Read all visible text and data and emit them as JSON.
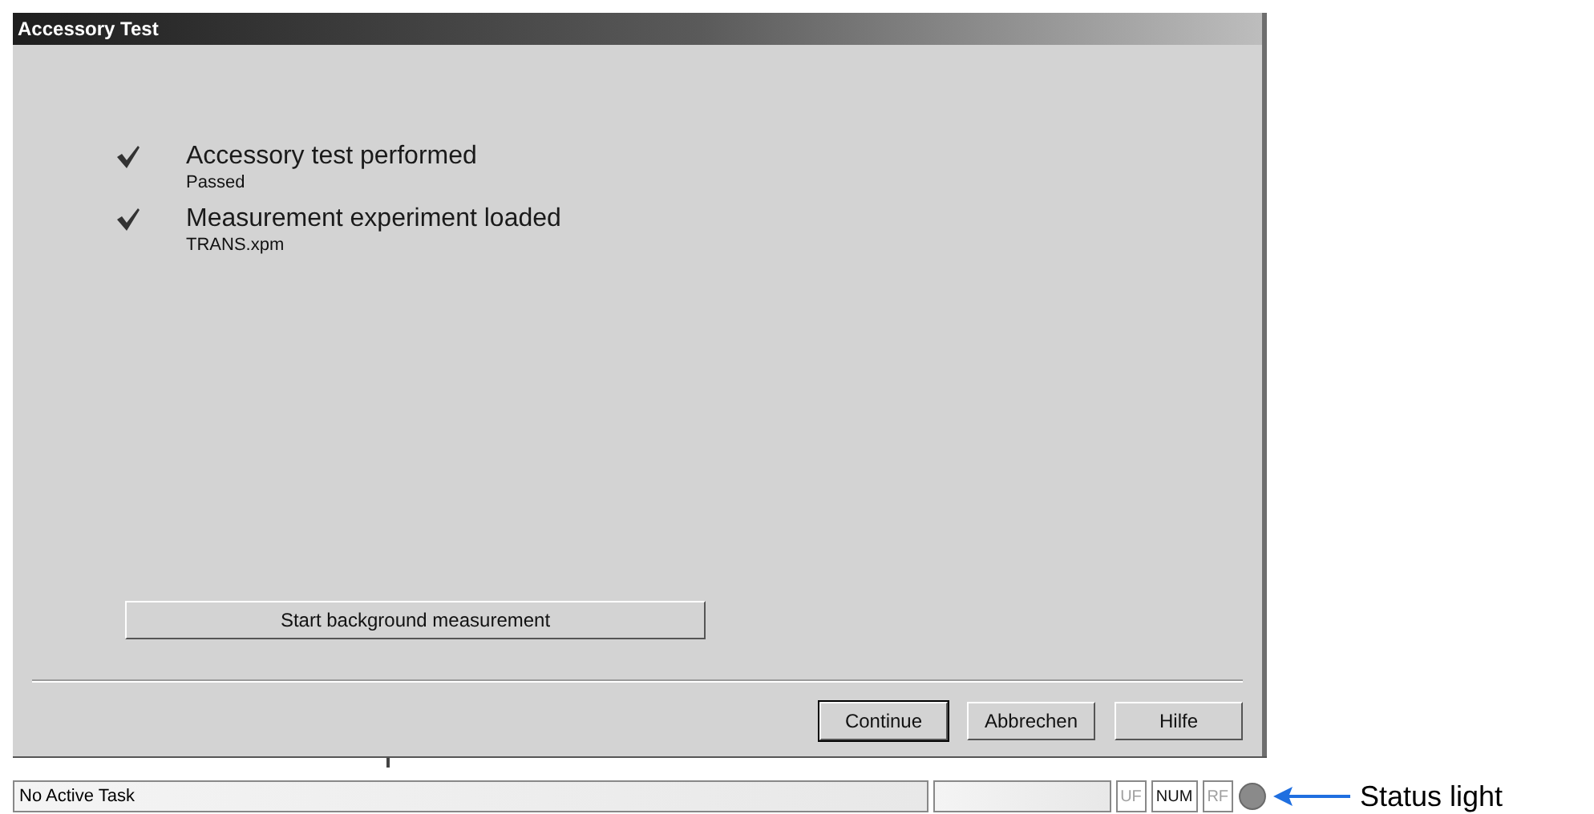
{
  "window": {
    "title": "Accessory Test"
  },
  "checklist": [
    {
      "label": "Accessory test performed",
      "detail": "Passed",
      "checked": true
    },
    {
      "label": "Measurement experiment loaded",
      "detail": "TRANS.xpm",
      "checked": true
    }
  ],
  "action_button": {
    "label": "Start background measurement"
  },
  "buttons": [
    {
      "label": "Continue",
      "default": true
    },
    {
      "label": "Abbrechen",
      "default": false
    },
    {
      "label": "Hilfe",
      "default": false
    }
  ],
  "status_bar": {
    "task": "No Active Task",
    "indicators": [
      {
        "label": "UF",
        "active": false
      },
      {
        "label": "NUM",
        "active": true
      },
      {
        "label": "RF",
        "active": false
      }
    ]
  },
  "annotation": {
    "label": "Status light"
  }
}
